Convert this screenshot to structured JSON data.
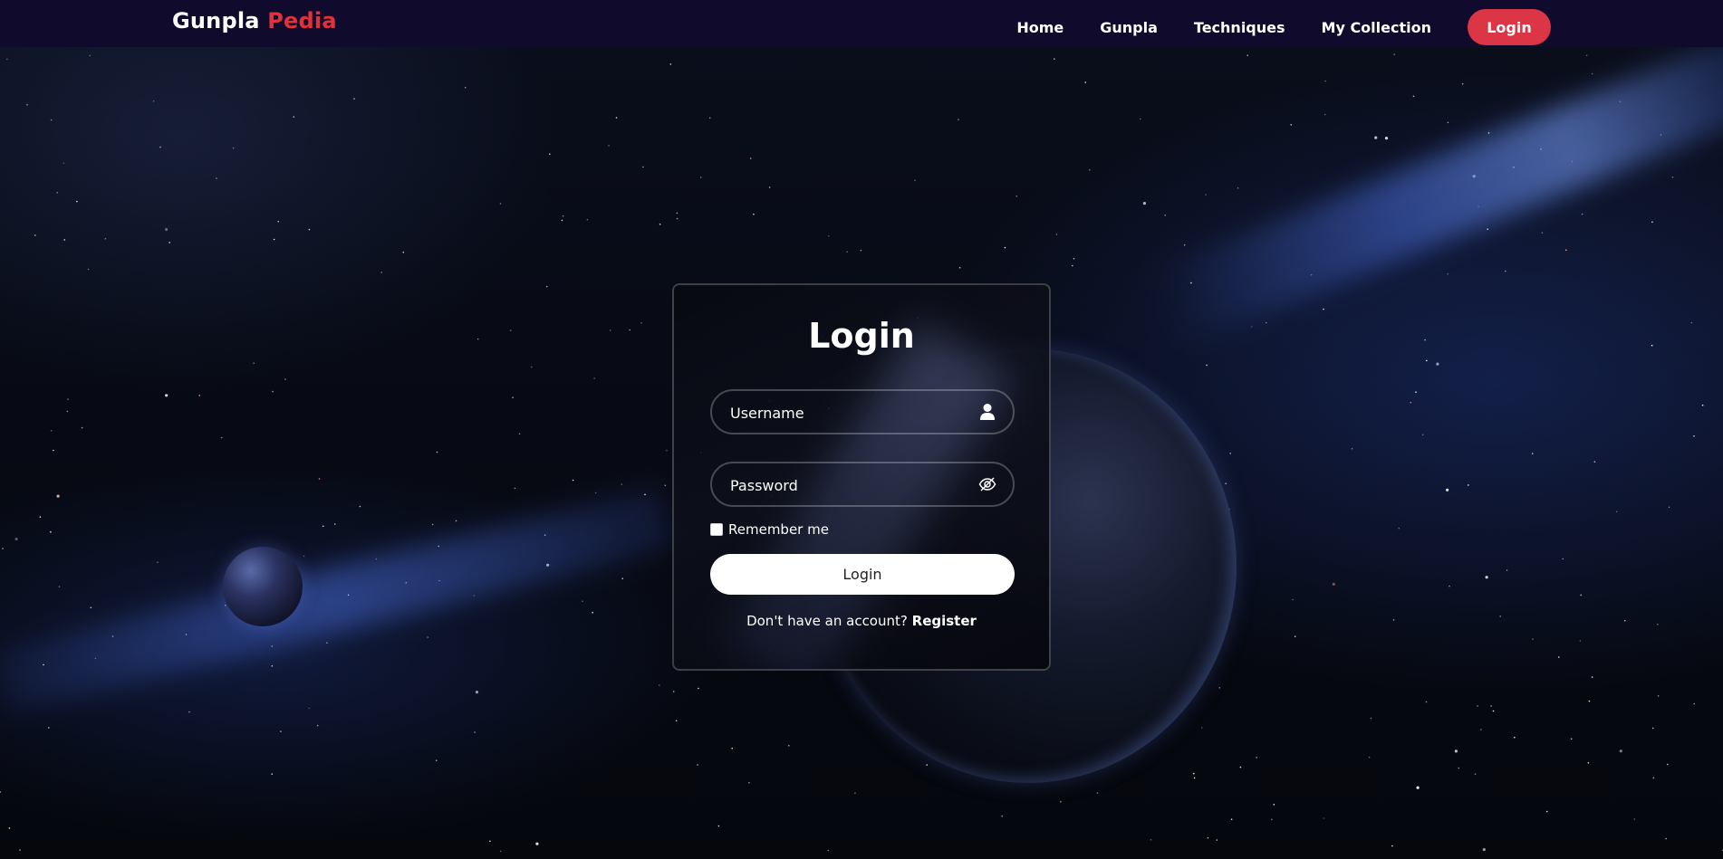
{
  "navbar": {
    "brand_main": "Gunpla",
    "brand_accent": "Pedia",
    "links": [
      "Home",
      "Gunpla",
      "Techniques",
      "My Collection"
    ],
    "login_label": "Login"
  },
  "login_form": {
    "title": "Login",
    "username_placeholder": "Username",
    "password_placeholder": "Password",
    "remember_label": "Remember me",
    "submit_label": "Login",
    "register_prompt": "Don't have an account?",
    "register_link": "Register"
  },
  "colors": {
    "navbar_bg": "#100a2c",
    "accent": "#dc3545",
    "card_border": "rgba(255,255,255,0.22)"
  },
  "icons": {
    "username": "user-icon",
    "password": "eye-slash-icon"
  }
}
